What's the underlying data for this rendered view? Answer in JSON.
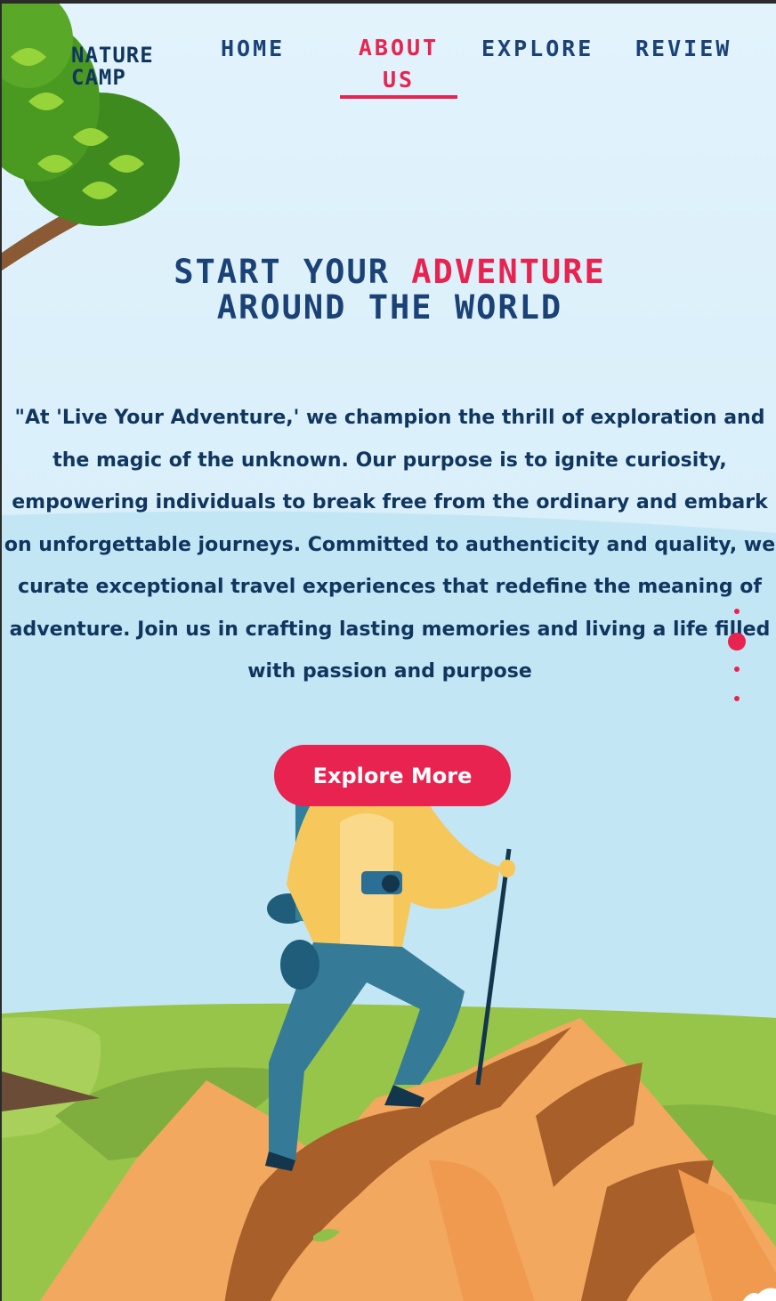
{
  "brand": {
    "logo_line1": "NATURE",
    "logo_line2": "CAMP"
  },
  "nav": {
    "home": "HOME",
    "about_line1": "ABOUT",
    "about_line2": "US",
    "explore": "EXPLORE",
    "review": "REVIEW",
    "active": "about"
  },
  "hero": {
    "title_part1": "START YOUR ",
    "title_accent": "ADVENTURE",
    "title_line2": "AROUND THE WORLD",
    "body": "\"At 'Live Your Adventure,' we champion the thrill of exploration and the magic of the unknown. Our purpose is to ignite curiosity, empowering individuals to break free from the ordinary and embark on unforgettable journeys. Committed to authenticity and quality, we curate exceptional travel experiences that redefine the meaning of adventure. Join us in crafting lasting memories and living a life filled with passion and purpose",
    "cta_label": "Explore More"
  },
  "carousel": {
    "slides": 4,
    "active_index": 1
  },
  "colors": {
    "navy": "#1b4277",
    "accent": "#e8234f",
    "sky": "#c3e6f5",
    "grass": "#8ec04a",
    "rock": "#f2a85e"
  },
  "icons": [
    "tree-illustration",
    "hiker-illustration",
    "mountain-rocks-illustration",
    "slide-dot"
  ]
}
